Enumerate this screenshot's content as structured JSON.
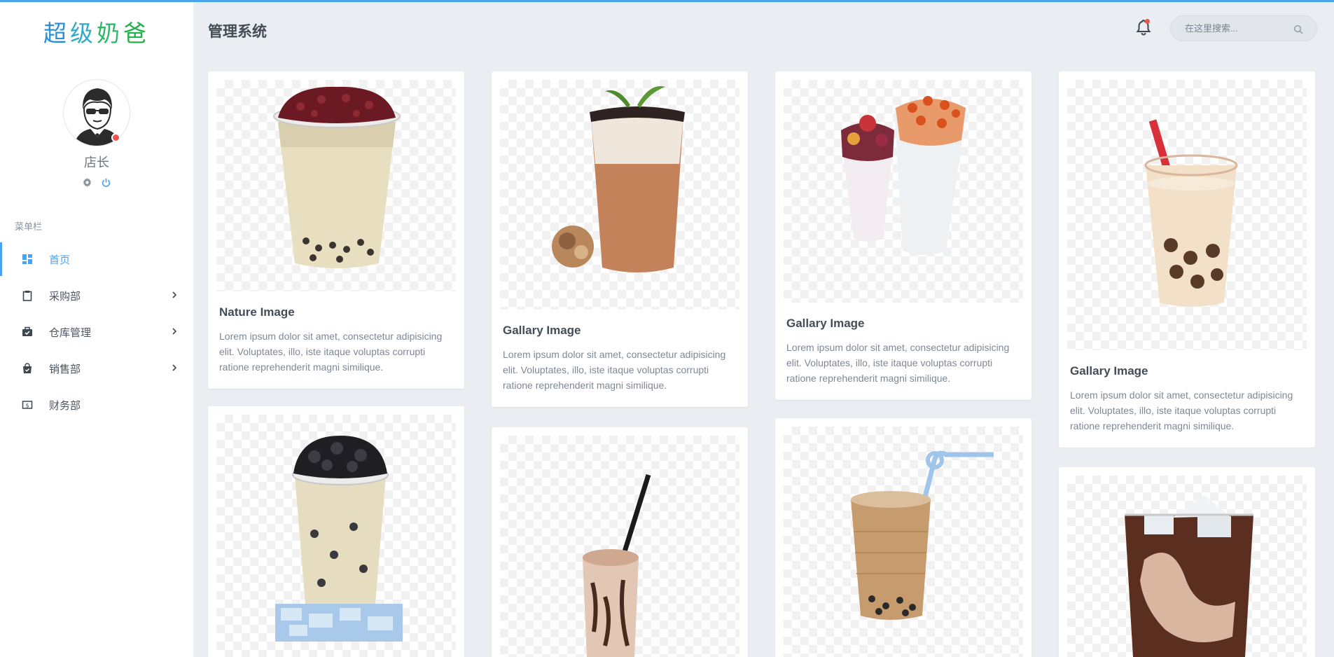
{
  "brand": {
    "chars": [
      "超",
      "级",
      "奶",
      "爸"
    ]
  },
  "user": {
    "name": "店长",
    "status": "online"
  },
  "sidebar": {
    "menu_title": "菜单栏",
    "items": [
      {
        "label": "首页",
        "icon": "dashboard-icon",
        "active": true,
        "has_submenu": false
      },
      {
        "label": "采购部",
        "icon": "clipboard-icon",
        "active": false,
        "has_submenu": true
      },
      {
        "label": "仓库管理",
        "icon": "briefcase-check-icon",
        "active": false,
        "has_submenu": true
      },
      {
        "label": "销售部",
        "icon": "shopping-bag-icon",
        "active": false,
        "has_submenu": true
      },
      {
        "label": "财务部",
        "icon": "money-icon",
        "active": false,
        "has_submenu": false
      }
    ]
  },
  "header": {
    "title": "管理系统",
    "search": {
      "placeholder": "在这里搜索...",
      "value": ""
    },
    "notifications": {
      "icon": "bell-icon",
      "has_unread": true
    }
  },
  "colors": {
    "accent": "#4aa3f0",
    "page_bg": "#eaedf1",
    "alert": "#ef5350"
  },
  "cards": [
    {
      "title": "Nature Image",
      "text": "Lorem ipsum dolor sit amet, consectetur adipisicing elit. Voluptates, illo, iste itaque voluptas corrupti ratione reprehenderit magni similique.",
      "image": "bubble-tea-red-bean"
    },
    {
      "title": "Gallary Image",
      "text": "Lorem ipsum dolor sit amet, consectetur adipisicing elit. Voluptates, illo, iste itaque voluptas corrupti ratione reprehenderit magni similique.",
      "image": "milk-tea-oreo-mint"
    },
    {
      "title": "Gallary Image",
      "text": "Lorem ipsum dolor sit amet, consectetur adipisicing elit. Voluptates, illo, iste itaque voluptas corrupti ratione reprehenderit magni similique.",
      "image": "two-fruit-teas"
    },
    {
      "title": "Gallary Image",
      "text": "Lorem ipsum dolor sit amet, consectetur adipisicing elit. Voluptates, illo, iste itaque voluptas corrupti ratione reprehenderit magni similique.",
      "image": "milk-tea-red-straw"
    },
    {
      "title": "",
      "text": "",
      "image": "bubble-tea-ice"
    },
    {
      "title": "",
      "text": "",
      "image": "chocolate-shake"
    },
    {
      "title": "",
      "text": "",
      "image": "milk-tea-blue-straw"
    },
    {
      "title": "",
      "text": "",
      "image": "iced-coffee"
    }
  ]
}
